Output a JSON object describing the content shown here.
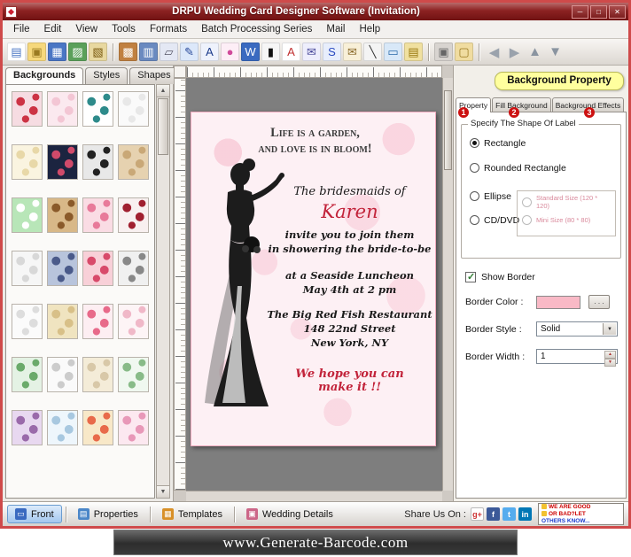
{
  "window": {
    "title": "DRPU Wedding Card Designer Software (Invitation)",
    "minimize": "─",
    "maximize": "□",
    "close": "✕"
  },
  "menu": {
    "items": [
      "File",
      "Edit",
      "View",
      "Tools",
      "Formats",
      "Batch Processing Series",
      "Mail",
      "Help"
    ]
  },
  "toolbar": {
    "icons": [
      {
        "name": "new-file-icon",
        "glyph": "▤",
        "fg": "#4a76c4",
        "bg": "#ffffff"
      },
      {
        "name": "open-folder-icon",
        "glyph": "▣",
        "fg": "#9a7a20",
        "bg": "#f6d87c"
      },
      {
        "name": "save-icon",
        "glyph": "▦",
        "fg": "#ffffff",
        "bg": "#4a76c4"
      },
      {
        "name": "image-icon",
        "glyph": "▨",
        "fg": "#ffffff",
        "bg": "#5aa05a"
      },
      {
        "name": "export-icon",
        "glyph": "▧",
        "fg": "#7a5a10",
        "bg": "#e8d8a0"
      },
      {
        "separator": true
      },
      {
        "name": "picture-icon",
        "glyph": "▩",
        "fg": "#ffffff",
        "bg": "#c08040"
      },
      {
        "name": "print-icon",
        "glyph": "▥",
        "fg": "#ffffff",
        "bg": "#6a8ac0"
      },
      {
        "name": "copy-icon",
        "glyph": "▱",
        "fg": "#555566",
        "bg": "#e4e8f4"
      },
      {
        "name": "pen-icon",
        "glyph": "✎",
        "fg": "#2a4a9a",
        "bg": "#dce8fa"
      },
      {
        "name": "text-icon",
        "glyph": "A",
        "fg": "#1a3a8a",
        "bg": "#eef2fc"
      },
      {
        "name": "color-wheel-icon",
        "glyph": "●",
        "fg": "#d04a9a",
        "bg": "#fdeef6"
      },
      {
        "name": "wordart-icon",
        "glyph": "W",
        "fg": "#ffffff",
        "bg": "#3a6ac0"
      },
      {
        "name": "barcode-icon",
        "glyph": "▮",
        "fg": "#111111",
        "bg": "#f6f6f6"
      },
      {
        "name": "font-color-icon",
        "glyph": "A",
        "fg": "#c03030",
        "bg": "#ffffff"
      },
      {
        "name": "mail-icon",
        "glyph": "✉",
        "fg": "#4a4a9a",
        "bg": "#eeeefc"
      },
      {
        "name": "signature-icon",
        "glyph": "S",
        "fg": "#2a4ac0",
        "bg": "#e8eefc"
      },
      {
        "name": "envelope-icon",
        "glyph": "✉",
        "fg": "#8a6a2a",
        "bg": "#f8f0d8"
      },
      {
        "name": "line-icon",
        "glyph": "╲",
        "fg": "#333333",
        "bg": "#f4f4f4"
      },
      {
        "name": "ruler-icon",
        "glyph": "▭",
        "fg": "#2a6aaa",
        "bg": "#d8e8f8"
      },
      {
        "name": "database-icon",
        "glyph": "▤",
        "fg": "#9a7a10",
        "bg": "#f0e0a0"
      },
      {
        "separator": true
      },
      {
        "name": "lock-icon",
        "glyph": "▣",
        "fg": "#666666",
        "bg": "#d8d4d0"
      },
      {
        "name": "unlock-icon",
        "glyph": "▢",
        "fg": "#9a7a20",
        "bg": "#f0dca0"
      },
      {
        "separator": true
      },
      {
        "name": "back-arrow-icon",
        "glyph": "◀",
        "fg": "#9aa2ac",
        "bg": "transparent"
      },
      {
        "name": "forward-arrow-icon",
        "glyph": "▶",
        "fg": "#9aa2ac",
        "bg": "transparent"
      },
      {
        "name": "up-arrow-icon",
        "glyph": "▲",
        "fg": "#8a94a0",
        "bg": "transparent"
      },
      {
        "name": "down-arrow-icon",
        "glyph": "▼",
        "fg": "#8a94a0",
        "bg": "transparent"
      }
    ]
  },
  "left_panel": {
    "tabs": [
      "Backgrounds",
      "Styles",
      "Shapes"
    ],
    "active_tab": "Backgrounds",
    "thumbnails": [
      {
        "name": "hearts-pattern",
        "c1": "#cc3344",
        "c2": "#f6dce2"
      },
      {
        "name": "pink-floral",
        "c1": "#f3c6d4",
        "c2": "#fbe9ef"
      },
      {
        "name": "teal-mandala",
        "c1": "#2e8b8b",
        "c2": "#ffffff"
      },
      {
        "name": "plain-white",
        "c1": "#e8e8e8",
        "c2": "#fafafa"
      },
      {
        "name": "cream-floral",
        "c1": "#e8d8a8",
        "c2": "#faf4e0"
      },
      {
        "name": "navy-floral",
        "c1": "#d04a6a",
        "c2": "#1c2440"
      },
      {
        "name": "black-lace",
        "c1": "#222222",
        "c2": "#e8e8e8"
      },
      {
        "name": "tan-texture",
        "c1": "#c9a877",
        "c2": "#e6d2b0"
      },
      {
        "name": "green-wave",
        "c1": "#ffffff",
        "c2": "#b8e6b8"
      },
      {
        "name": "tan-paisley",
        "c1": "#8a5a2a",
        "c2": "#d8b888"
      },
      {
        "name": "pink-blossom",
        "c1": "#e87a9a",
        "c2": "#fadce4"
      },
      {
        "name": "red-ornament",
        "c1": "#a02030",
        "c2": "#f8f0f0"
      },
      {
        "name": "white-damask",
        "c1": "#d8d8d8",
        "c2": "#f6f6f6"
      },
      {
        "name": "blue-paisley",
        "c1": "#4a5a8a",
        "c2": "#b8c4dc"
      },
      {
        "name": "rose-bouquet",
        "c1": "#d84a6a",
        "c2": "#f8d0d8"
      },
      {
        "name": "gray-sketch-floral",
        "c1": "#888888",
        "c2": "#f0f0f0"
      },
      {
        "name": "white-mini-floral",
        "c1": "#dddddd",
        "c2": "#fbfbfb"
      },
      {
        "name": "gold-texture",
        "c1": "#d8c088",
        "c2": "#f0e4c0"
      },
      {
        "name": "pink-hearts",
        "c1": "#e86a8a",
        "c2": "#fdeef2"
      },
      {
        "name": "soft-pink-floral",
        "c1": "#f0b8c8",
        "c2": "#fdf4f6"
      },
      {
        "name": "green-floral",
        "c1": "#6aaa6a",
        "c2": "#e4f2e4"
      },
      {
        "name": "white-vine",
        "c1": "#cccccc",
        "c2": "#fafafa"
      },
      {
        "name": "beige-ornament",
        "c1": "#d8c8a8",
        "c2": "#f4ecd8"
      },
      {
        "name": "green-dots",
        "c1": "#88bb88",
        "c2": "#f0f8f0"
      },
      {
        "name": "purple-floral",
        "c1": "#9a6aaa",
        "c2": "#e8d8f0"
      },
      {
        "name": "blue-dots",
        "c1": "#a8c8e0",
        "c2": "#eef6fc"
      },
      {
        "name": "multi-stripe",
        "c1": "#e86a4a",
        "c2": "#f8e8c8"
      },
      {
        "name": "pink-lace",
        "c1": "#e898b8",
        "c2": "#fce8f0"
      }
    ]
  },
  "card": {
    "title_line1": "Life is a garden,",
    "title_line2": "and love is in bloom!",
    "intro": "The bridesmaids of",
    "bride_name": "Karen",
    "invite_line1": "invite you to join them",
    "invite_line2": "in showering the bride-to-be",
    "event_line1": "at a Seaside Luncheon",
    "event_line2": "May 4th at 2 pm",
    "venue_line1": "The Big Red Fish Restaurant",
    "venue_line2": "148 22nd Street",
    "venue_line3": "New York, NY",
    "closing_line1": "We hope you can",
    "closing_line2": "make it !!"
  },
  "right_panel": {
    "header": "Background Property",
    "tabs": [
      {
        "label": "Property",
        "badge": "1"
      },
      {
        "label": "Fill Background",
        "badge": "2"
      },
      {
        "label": "Background Effects",
        "badge": "3"
      }
    ],
    "active_tab": "Property",
    "shape_group": {
      "title": "Specify The Shape Of Label",
      "options": [
        "Rectangle",
        "Rounded Rectangle",
        "Ellipse",
        "CD/DVD"
      ],
      "selected": "Rectangle",
      "size_options": [
        "Standard Size (120 * 120)",
        "Mini Size (80 * 80)"
      ]
    },
    "border_section": {
      "show_border": "Show Border",
      "show_border_checked": true,
      "color_label": "Border Color :",
      "color_value": "#f9b9c6",
      "browse_button": ". . .",
      "style_label": "Border Style :",
      "style_value": "Solid",
      "width_label": "Border Width :",
      "width_value": "1"
    }
  },
  "bottom_bar": {
    "buttons": [
      {
        "label": "Front",
        "icon": "▭",
        "icon_color": "#3a6ac0",
        "active": true
      },
      {
        "label": "Properties",
        "icon": "▤",
        "icon_color": "#4a86c8",
        "active": false
      },
      {
        "label": "Templates",
        "icon": "▦",
        "icon_color": "#d89028",
        "active": false
      },
      {
        "label": "Wedding Details",
        "icon": "▣",
        "icon_color": "#cc6688",
        "active": false
      }
    ],
    "share_label": "Share Us On :",
    "social": [
      {
        "name": "google-plus-icon",
        "text": "g+",
        "fg": "#cc3333",
        "bg": "#ffffff"
      },
      {
        "name": "facebook-icon",
        "text": "f",
        "fg": "#ffffff",
        "bg": "#3b5998"
      },
      {
        "name": "twitter-icon",
        "text": "t",
        "fg": "#ffffff",
        "bg": "#55acee"
      },
      {
        "name": "linkedin-icon",
        "text": "in",
        "fg": "#ffffff",
        "bg": "#0077b5"
      }
    ],
    "feedback_lines": [
      "WE ARE GOOD",
      "OR BAD?LET",
      "OTHERS KNOW..."
    ]
  },
  "watermark": "www.Generate-Barcode.com"
}
